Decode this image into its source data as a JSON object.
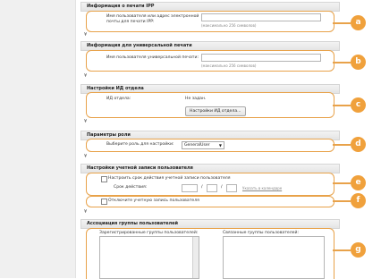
{
  "ipp": {
    "header": "Информация о печати IPP",
    "label_line1": "Имя пользователя или адрес электронной",
    "label_line2": "почты для печати IPP:",
    "input_value": "",
    "hint": "(максимально 256 символов)"
  },
  "universal": {
    "header": "Информация для универсальной печати",
    "label": "Имя пользователя универсальной печати:",
    "input_value": "",
    "hint": "(максимально 256 символов)"
  },
  "dept": {
    "header": "Настройки ИД отдела",
    "label": "ИД отдела:",
    "value": "Не задан.",
    "button": "Настройки ИД отдела..."
  },
  "role": {
    "header": "Параметры роли",
    "label": "Выберите роль для настройки:",
    "selected": "GeneralUser"
  },
  "account": {
    "header": "Настройки учетной записи пользователя",
    "expiry_checkbox": "Настроить срок действия учетной записи пользователя",
    "expiry_label": "Срок действия:",
    "date_sep1": "/",
    "date_sep2": "/",
    "date_hint": "Указать в календаре",
    "disable_checkbox": "Отключите учетную запись пользователя"
  },
  "groups": {
    "header": "Ассоциация группы пользователей",
    "registered_label": "Зарегистрированные группы пользователей:",
    "linked_label": "Связанные группы пользователей:"
  },
  "divider_glyph": "¥",
  "badges": [
    "a",
    "b",
    "c",
    "d",
    "e",
    "f",
    "g"
  ],
  "accent_color": "#f0a13c"
}
